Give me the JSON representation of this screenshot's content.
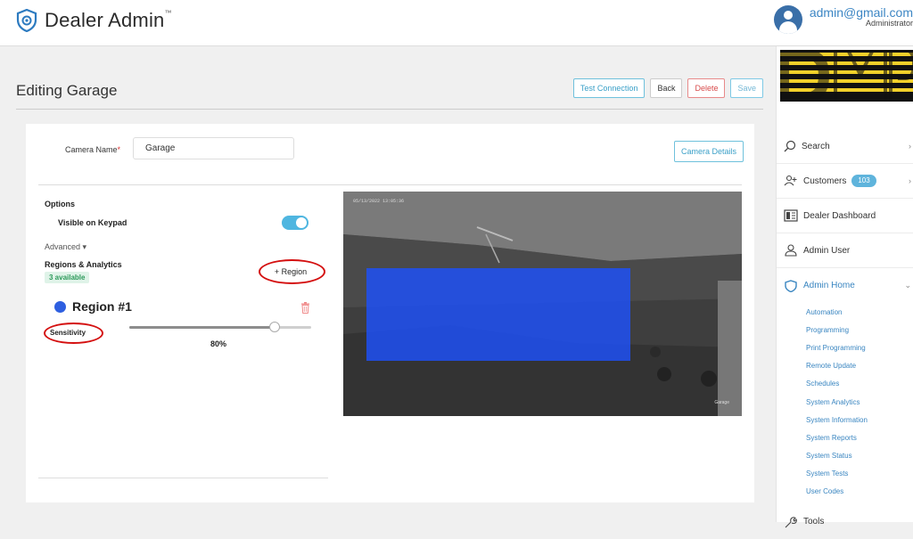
{
  "header": {
    "app_title": "Dealer Admin",
    "tm": "™",
    "user_email": "admin@gmail.com",
    "user_role": "Administrator"
  },
  "page": {
    "title": "Editing Garage",
    "actions": {
      "test_connection": "Test Connection",
      "back": "Back",
      "delete": "Delete",
      "save": "Save"
    }
  },
  "form": {
    "camera_name_label": "Camera Name",
    "required_mark": "*",
    "camera_name_value": "Garage",
    "camera_details_button": "Camera Details",
    "options_title": "Options",
    "visible_on_keypad_label": "Visible on Keypad",
    "visible_on_keypad_on": true,
    "advanced_label": "Advanced ▾",
    "regions_title": "Regions & Analytics",
    "regions_available": "3 available",
    "add_region_label": "+ Region",
    "region": {
      "name": "Region #1",
      "color": "#2e5fe0",
      "sensitivity_label": "Sensitivity",
      "sensitivity_value": "80%",
      "sensitivity_fraction": 0.8
    }
  },
  "camera_view": {
    "timestamp": "05/13/2022 13:05:36",
    "camera_label": "Garage",
    "region_color": "#1e50f5"
  },
  "sidebar": {
    "brand": "DMP",
    "items": [
      {
        "label": "Search",
        "icon": "search-icon"
      },
      {
        "label": "Customers",
        "icon": "customers-icon",
        "badge": "103"
      },
      {
        "label": "Dealer Dashboard",
        "icon": "dashboard-icon"
      },
      {
        "label": "Admin User",
        "icon": "user-icon"
      },
      {
        "label": "Admin Home",
        "icon": "shield-icon"
      }
    ],
    "sub_items": [
      "Automation",
      "Programming",
      "Print Programming",
      "Remote Update",
      "Schedules",
      "System Analytics",
      "System Information",
      "System Reports",
      "System Status",
      "System Tests",
      "User Codes"
    ],
    "tools": "Tools",
    "accent": "#3a86c1"
  }
}
